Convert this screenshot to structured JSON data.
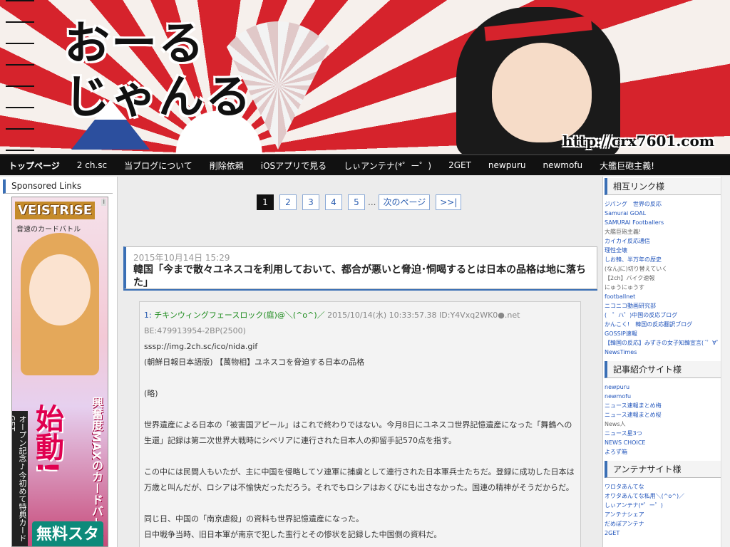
{
  "banner": {
    "title_line1": "おーる",
    "title_line2": "じゃんる",
    "url": "http://crx7601.com"
  },
  "nav": {
    "items": [
      "トップページ",
      "2 ch.sc",
      "当ブログについて",
      "削除依頼",
      "iOSアプリで見る",
      "しぃアンテナ(*゜ー゜)",
      "2GET",
      "newpuru",
      "newmofu",
      "大艦巨砲主義!"
    ]
  },
  "left_sidebar": {
    "heading": "Sponsored Links",
    "ad": {
      "brand": "VEISTRISE",
      "brand_sub": "音速のカードバトル",
      "info": "i",
      "catch": "興奮度MAXのカードバトル",
      "big": "始動!",
      "side": "オープン記念♪今初めて特典カードGET",
      "free": "無料スタート"
    }
  },
  "pager": {
    "pages": [
      "1",
      "2",
      "3",
      "4",
      "5"
    ],
    "dots": "...",
    "next": "次のページ",
    "last": ">>|"
  },
  "article": {
    "date": "2015年10月14日 15:29",
    "title": "韓国「今まで散々ユネスコを利用しておいて、都合が悪いと脅迫･恫喝するとは日本の品格は地に落ちた」",
    "post_num": "1:",
    "post_name": "チキンウィングフェースロック(庭)@＼(^o^)／",
    "post_meta": "2015/10/14(水) 10:33:57.38 ID:Y4Vxq2WK0●.net BE:479913954-2BP(2500)",
    "lines": [
      "sssp://img.2ch.sc/ico/nida.gif",
      "(朝鮮日報日本語版) 【萬物相】ユネスコを脅迫する日本の品格",
      "",
      "(略)",
      "",
      "世界遺産による日本の「被害国アピール」はこれで終わりではない。今月8日にユネスコ世界記憶遺産になった「舞鶴への生還」記録は第二次世界大戦時にシベリアに連行された日本人の抑留手記570点を指す。",
      "",
      "この中には民間人もいたが、主に中国を侵略してソ連軍に捕虜として連行された日本軍兵士たちだ。登録に成功した日本は万歳と叫んだが、ロシアは不愉快だっただろう。それでもロシアはおくびにも出さなかった。国連の精神がそうだからだ。",
      "",
      "同じ日、中国の「南京虐殺」の資料も世界記憶遺産になった。",
      "日中戦争当時、旧日本軍が南京で犯した蛮行とその惨状を記録した中国側の資料だ。"
    ]
  },
  "right_sidebar": {
    "sections": [
      {
        "heading": "相互リンク様",
        "items": [
          {
            "t": "ジパング　世界の反応",
            "gray": false
          },
          {
            "t": "Samurai GOAL",
            "gray": false
          },
          {
            "t": "SAMURAI Footballers",
            "gray": false
          },
          {
            "t": "大艦巨砲主義!",
            "gray": true
          },
          {
            "t": "カイカイ反応通信",
            "gray": false
          },
          {
            "t": "理性全壊",
            "gray": false
          },
          {
            "t": "しお韓、半万年の歴史",
            "gray": false
          },
          {
            "t": "(なんJに)切り替えていく",
            "gray": true
          },
          {
            "t": "【2ch】バイク速報",
            "gray": true
          },
          {
            "t": "にゅうにゅうす",
            "gray": true
          },
          {
            "t": "footballnet",
            "gray": false
          },
          {
            "t": "ニコニコ動画研究部",
            "gray": false
          },
          {
            "t": "(　゜ハ゜)中国の反応ブログ",
            "gray": false
          },
          {
            "t": "かんこく!　韓国の反応翻訳ブログ",
            "gray": false
          },
          {
            "t": "GOSSIP速報",
            "gray": false
          },
          {
            "t": "【韓国の反応】みずきの女子知韓宣言(´゜∀゜`)",
            "gray": false
          },
          {
            "t": "NewsTimes",
            "gray": false
          }
        ]
      },
      {
        "heading": "記事紹介サイト様",
        "items": [
          {
            "t": "newpuru",
            "gray": false
          },
          {
            "t": "newmofu",
            "gray": false
          },
          {
            "t": "ニュース速報まとめ梅",
            "gray": false
          },
          {
            "t": "ニュース速報まとめ桜",
            "gray": false
          },
          {
            "t": "News人",
            "gray": true
          },
          {
            "t": "ニュース星3つ",
            "gray": false
          },
          {
            "t": "NEWS CHOICE",
            "gray": false
          },
          {
            "t": "よろず箱",
            "gray": false
          }
        ]
      },
      {
        "heading": "アンテナサイト様",
        "items": [
          {
            "t": "ワロタあんてな",
            "gray": false
          },
          {
            "t": "オワタあんてな私用＼(^o^)／",
            "gray": false
          },
          {
            "t": "しぃアンテナ(*゜ー゜)",
            "gray": false
          },
          {
            "t": "アンテナシェア",
            "gray": false
          },
          {
            "t": "だめぽアンテナ",
            "gray": false
          },
          {
            "t": "2GET",
            "gray": false
          }
        ]
      }
    ]
  }
}
